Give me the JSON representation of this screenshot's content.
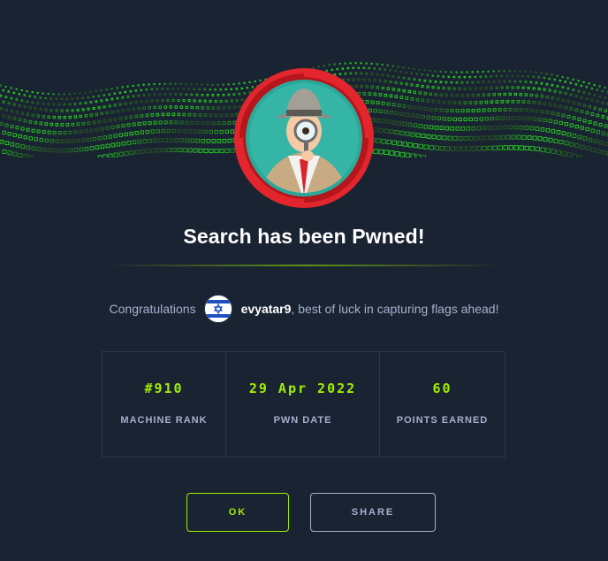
{
  "modal": {
    "title": "Search has been Pwned!",
    "badge_icon": "detective-magnifier-icon",
    "banner_icon": "green-cube-wave-icon"
  },
  "congrats": {
    "prefix": "Congratulations",
    "flag_icon": "israel-flag-icon",
    "username": "evyatar9",
    "suffix": ", best of luck in capturing flags ahead!"
  },
  "stats": [
    {
      "value": "#910",
      "label": "MACHINE RANK"
    },
    {
      "value": "29 Apr 2022",
      "label": "PWN DATE"
    },
    {
      "value": "60",
      "label": "POINTS EARNED"
    }
  ],
  "buttons": {
    "ok_label": "OK",
    "share_label": "SHARE"
  },
  "colors": {
    "background": "#1a2332",
    "accent_green": "#9fef00",
    "muted_text": "#a4b1cd",
    "badge_red": "#e3262d"
  }
}
